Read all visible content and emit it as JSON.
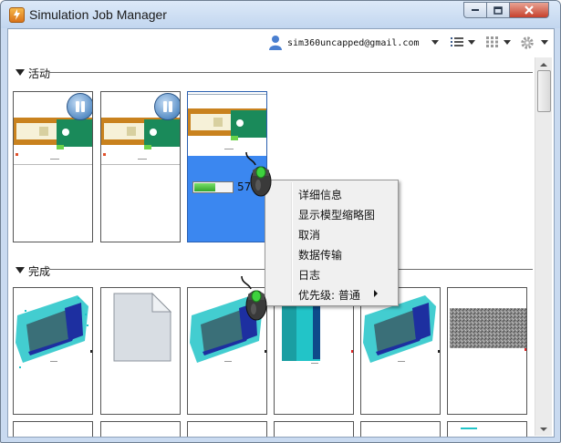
{
  "window": {
    "title": "Simulation Job Manager",
    "controls": [
      "minimize-icon",
      "maximize-icon",
      "close-icon"
    ]
  },
  "toolbar": {
    "user_email": "sim360uncapped@gmail.com",
    "icons": [
      "user-icon",
      "list-view-icon",
      "grid-view-icon",
      "gear-icon"
    ]
  },
  "sections": [
    {
      "label": "活动",
      "jobs": [
        {
          "image": "model-thumbnail",
          "state": "running",
          "control": "pause-icon"
        },
        {
          "image": "model-thumbnail",
          "state": "running",
          "control": "pause-icon"
        },
        {
          "image": "model-thumbnail",
          "state": "uploading",
          "selected": true,
          "progress": 57,
          "progress_label": "57%"
        }
      ]
    },
    {
      "label": "完成",
      "jobs": [
        {
          "image": "mesh-result-thumbnail"
        },
        {
          "image": "blank-document-icon"
        },
        {
          "image": "mesh-result-thumbnail"
        },
        {
          "image": "mesh-result-thumbnail"
        },
        {
          "image": "mesh-result-thumbnail"
        },
        {
          "image": "gray-noise-thumbnail"
        }
      ]
    }
  ],
  "context_menu": {
    "items": [
      "详细信息",
      "显示模型缩略图",
      "取消",
      "数据传输",
      "日志",
      "优先级: 普通"
    ],
    "submenu_arrow_on": "优先级: 普通"
  },
  "colors": {
    "selection": "#3b87f0",
    "progress": "#33a52a",
    "title_bar": "#c9daf0",
    "close_button": "#c7412c",
    "model_frame": "#c9821e",
    "mesh": "#22c4c8"
  }
}
